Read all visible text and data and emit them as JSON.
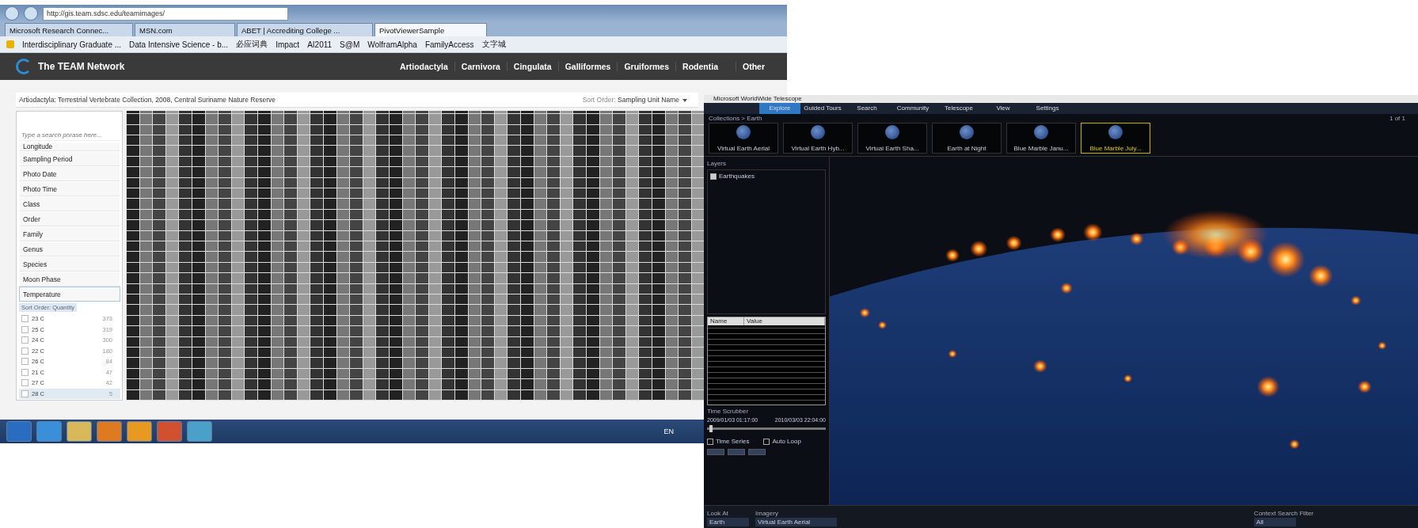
{
  "browser": {
    "address": "http://gis.team.sdsc.edu/teamimages/",
    "tabs": [
      {
        "label": "Microsoft Research Connec...",
        "selected": false
      },
      {
        "label": "MSN.com",
        "selected": false
      },
      {
        "label": "ABET | Accrediting College ...",
        "selected": false
      },
      {
        "label": "PivotViewerSample",
        "selected": true
      }
    ],
    "favorites": [
      "Interdisciplinary Graduate ...",
      "Data Intensive Science - b...",
      "必应词典",
      "Impact",
      "AI2011",
      "S@M",
      "WolframAlpha",
      "FamilyAccess",
      "文字城"
    ],
    "site": {
      "title": "The TEAM Network",
      "nav": [
        "Artiodactyla",
        "Carnivora",
        "Cingulata",
        "Galliformes",
        "Gruiformes",
        "Rodentia",
        "Other"
      ]
    },
    "breadcrumb": "Artiodactyla: Terrestrial Vertebrate Collection, 2008, Central Suriname Nature Reserve",
    "sort": {
      "label": "Sort Order:",
      "value": "Sampling Unit Name"
    },
    "search": {
      "placeholder": "Type a search phrase here..."
    },
    "facets": [
      {
        "label": "Longitude",
        "expanded": false
      },
      {
        "label": "Sampling Period",
        "expanded": false
      },
      {
        "label": "Photo Date",
        "expanded": false
      },
      {
        "label": "Photo Time",
        "expanded": false
      },
      {
        "label": "Class",
        "expanded": false
      },
      {
        "label": "Order",
        "expanded": false
      },
      {
        "label": "Family",
        "expanded": false
      },
      {
        "label": "Genus",
        "expanded": false
      },
      {
        "label": "Species",
        "expanded": false
      },
      {
        "label": "Moon Phase",
        "expanded": false
      },
      {
        "label": "Temperature",
        "expanded": true
      }
    ],
    "facet_sort": "Sort Order: Quantity",
    "values": [
      {
        "label": "23 C",
        "count": "373",
        "checked": false,
        "selected": false
      },
      {
        "label": "25 C",
        "count": "319",
        "checked": false,
        "selected": false
      },
      {
        "label": "24 C",
        "count": "300",
        "checked": false,
        "selected": false
      },
      {
        "label": "22 C",
        "count": "180",
        "checked": false,
        "selected": false
      },
      {
        "label": "26 C",
        "count": "84",
        "checked": false,
        "selected": false
      },
      {
        "label": "21 C",
        "count": "47",
        "checked": false,
        "selected": false
      },
      {
        "label": "27 C",
        "count": "42",
        "checked": false,
        "selected": false
      },
      {
        "label": "28 C",
        "count": "5",
        "checked": false,
        "selected": true
      }
    ],
    "taskbar": {
      "language": "EN"
    }
  },
  "wwt": {
    "title": "Microsoft WorldWide Telescope",
    "menu": [
      {
        "label": "Explore",
        "selected": true
      },
      {
        "label": "Guided Tours",
        "selected": false
      },
      {
        "label": "Search",
        "selected": false
      },
      {
        "label": "Community",
        "selected": false
      },
      {
        "label": "Telescope",
        "selected": false
      },
      {
        "label": "View",
        "selected": false
      },
      {
        "label": "Settings",
        "selected": false
      }
    ],
    "breadcrumb": "Collections > Earth",
    "pager": "1 of 1",
    "collections": [
      {
        "label": "Virtual Earth Aerial",
        "selected": false
      },
      {
        "label": "Virtual Earth Hyb...",
        "selected": false
      },
      {
        "label": "Virtual Earth Sha...",
        "selected": false
      },
      {
        "label": "Earth at Night",
        "selected": false
      },
      {
        "label": "Blue Marble Janu...",
        "selected": false
      },
      {
        "label": "Blue Marble July...",
        "selected": true
      }
    ],
    "layers": {
      "title": "Layers",
      "items": [
        {
          "label": "Earthquakes",
          "checked": true
        }
      ]
    },
    "table": {
      "columns": [
        "Name",
        "Value"
      ]
    },
    "scrubber": {
      "title": "Time Scrubber",
      "start": "2009/01/03 01:17:00",
      "end": "2010/03/03 22:04:00",
      "level": 0.02
    },
    "options": [
      {
        "label": "Time Series",
        "checked": false
      },
      {
        "label": "Auto Loop",
        "checked": false
      }
    ],
    "look_at": {
      "label": "Look At",
      "value": "Earth"
    },
    "imagery": {
      "label": "Imagery",
      "value": "Virtual Earth Aerial"
    },
    "context_filter": {
      "label": "Context Search Filter",
      "value": "All"
    }
  }
}
